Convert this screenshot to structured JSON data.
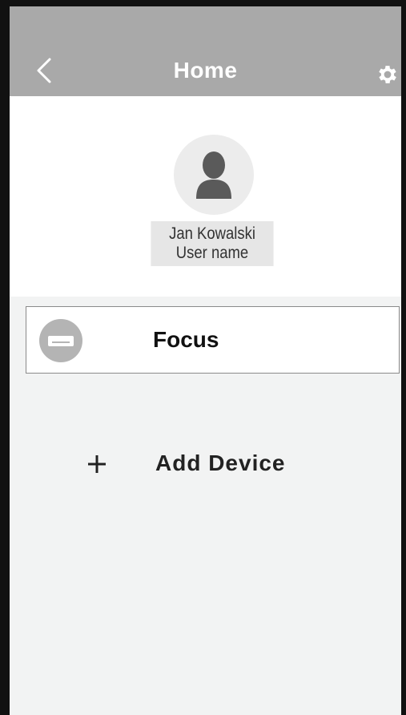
{
  "header": {
    "title": "Home",
    "back_icon": "chevron-left-icon",
    "settings_icon": "gear-icon",
    "background_color": "#a9a9a9"
  },
  "profile": {
    "avatar_icon": "user-avatar-icon",
    "display_name": "Jan Kowalski",
    "username_label": "User name"
  },
  "devices": [
    {
      "name": "Focus",
      "icon": "air-conditioner-icon"
    }
  ],
  "add_device": {
    "icon": "plus-icon",
    "label": "Add Device"
  }
}
